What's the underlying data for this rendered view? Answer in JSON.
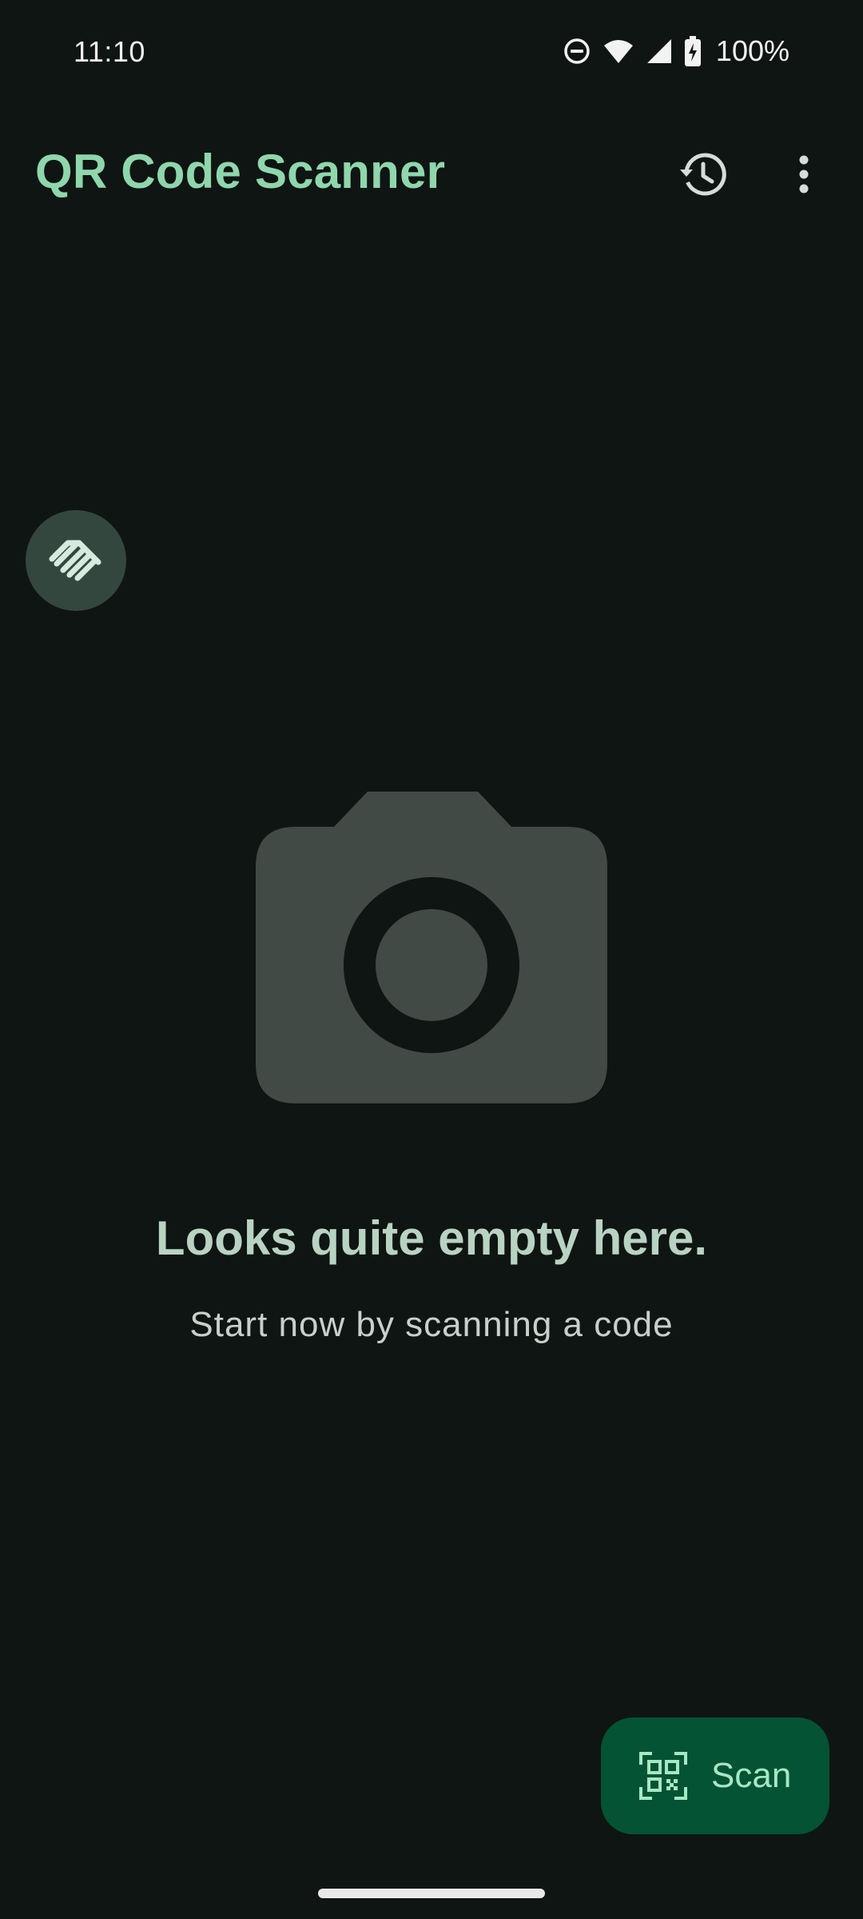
{
  "status_bar": {
    "time": "11:10",
    "battery_percent": "100%",
    "icons": [
      "do-not-disturb-icon",
      "wifi-icon",
      "cell-signal-icon",
      "battery-charging-icon"
    ]
  },
  "app_bar": {
    "title": "QR Code Scanner",
    "actions": [
      "history-icon",
      "more-vert-icon"
    ]
  },
  "empty_state": {
    "illustration": "camera-icon",
    "title": "Looks quite empty here.",
    "subtitle": "Start now by scanning a code"
  },
  "fab": {
    "label": "Scan",
    "icon": "qr-scan-icon"
  },
  "colors": {
    "background": "#0f1512",
    "title_green": "#8fd6ad",
    "fab_background": "#045335",
    "fab_text": "#a7e7c3",
    "illustration": "#414a45",
    "handshake_bg": "#33473e"
  }
}
